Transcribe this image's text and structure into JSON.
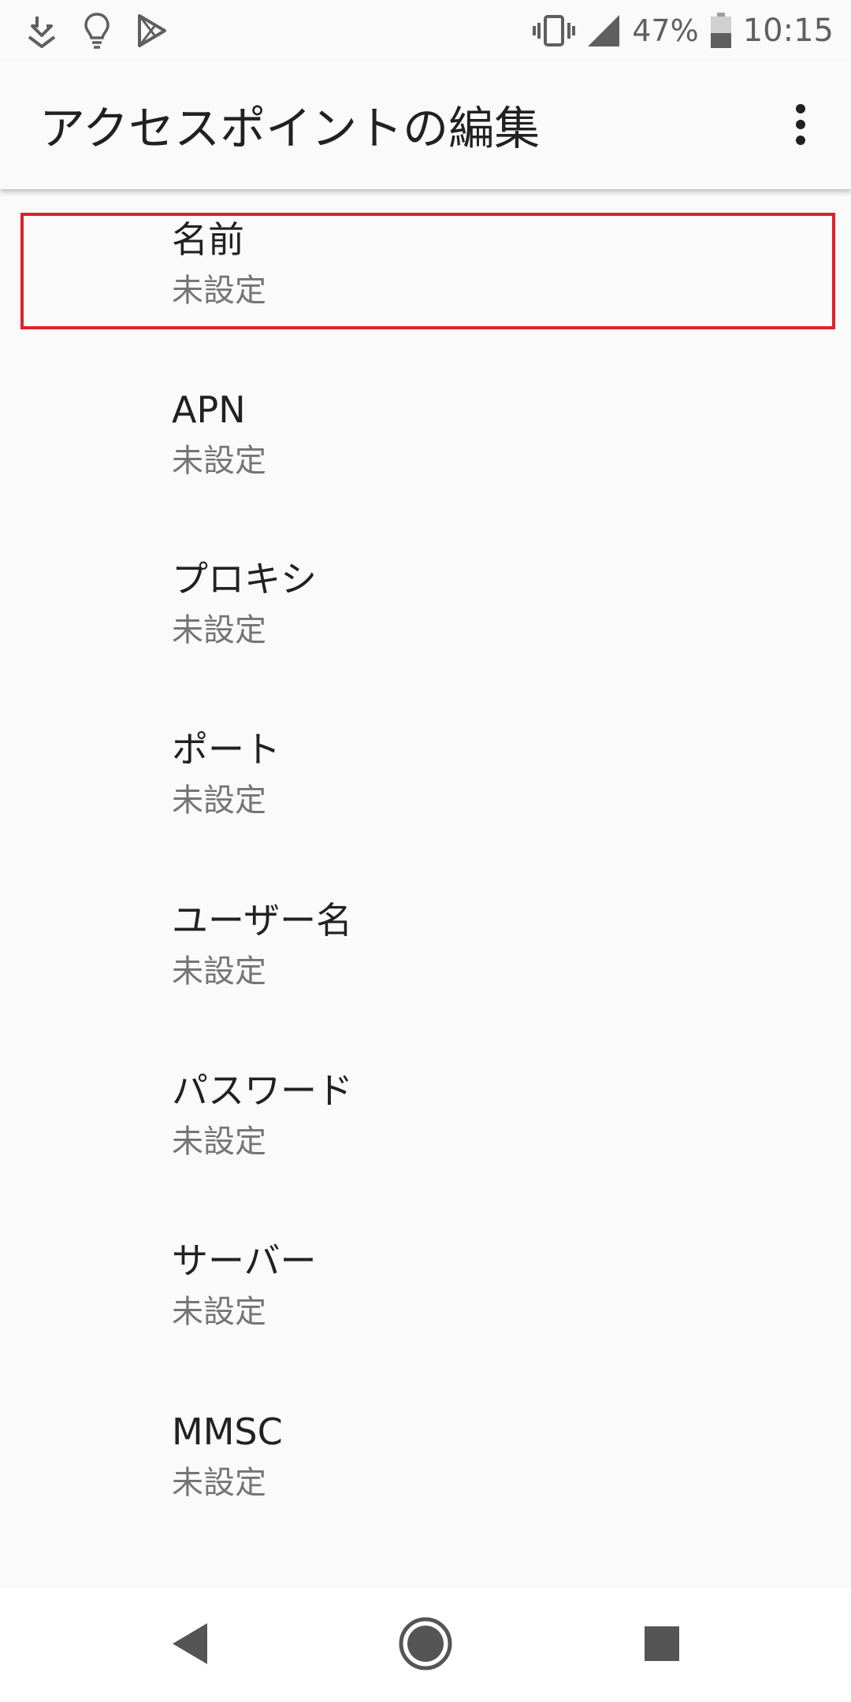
{
  "status_bar": {
    "left_icons": [
      "download-notification-icon",
      "lightbulb-icon",
      "play-store-icon"
    ],
    "battery_percent": "47%",
    "time": "10:15",
    "right_icons": [
      "vibrate-icon",
      "signal-icon",
      "battery-icon"
    ]
  },
  "app_bar": {
    "title": "アクセスポイントの編集",
    "overflow_icon": "more-vert-icon"
  },
  "preferences": [
    {
      "title": "名前",
      "summary": "未設定"
    },
    {
      "title": "APN",
      "summary": "未設定"
    },
    {
      "title": "プロキシ",
      "summary": "未設定"
    },
    {
      "title": "ポート",
      "summary": "未設定"
    },
    {
      "title": "ユーザー名",
      "summary": "未設定"
    },
    {
      "title": "パスワード",
      "summary": "未設定"
    },
    {
      "title": "サーバー",
      "summary": "未設定"
    },
    {
      "title": "MMSC",
      "summary": "未設定"
    }
  ],
  "nav_bar": {
    "icons": [
      "back-icon",
      "home-icon",
      "recents-icon"
    ]
  },
  "colors": {
    "background": "#fafafa",
    "highlight": "#e0202b",
    "title_text": "#212121",
    "summary_text": "#757575",
    "status_icons": "#5f5f5f"
  }
}
